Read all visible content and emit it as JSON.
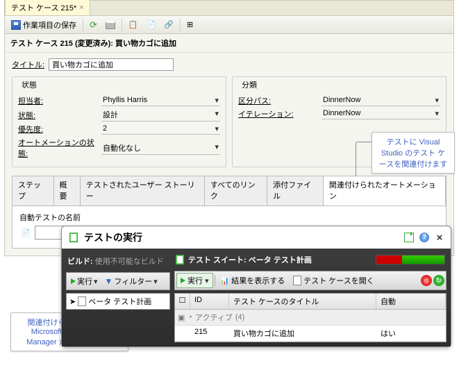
{
  "tab": {
    "title": "テスト ケース 215*"
  },
  "toolbar": {
    "save_label": "作業項目の保存"
  },
  "header": {
    "title": "テスト ケース 215 (変更済み): 買い物カゴに追加"
  },
  "title_field": {
    "label": "タイトル:",
    "value": "買い物カゴに追加"
  },
  "state": {
    "legend": "状態",
    "assigned_label": "担当者:",
    "assigned_value": "Phyllis Harris",
    "status_label": "状態:",
    "status_value": "設計",
    "priority_label": "優先度:",
    "priority_value": "2",
    "automation_label": "オートメーションの状態:",
    "automation_value": "自動化なし"
  },
  "classification": {
    "legend": "分類",
    "area_label": "区分パス:",
    "area_value": "DinnerNow",
    "iter_label": "イテレーション:",
    "iter_value": "DinnerNow"
  },
  "tabs": {
    "steps": "ステップ",
    "overview": "概要",
    "stories": "テストされたユーザー ストーリー",
    "links": "すべてのリンク",
    "attach": "添付ファイル",
    "automation": "関連付けられたオートメーション"
  },
  "auto_panel": {
    "name_label": "自動テストの名前",
    "value": "",
    "browse": "..."
  },
  "callout1": "テストに Visual Studio のテスト ケースを関連付けます",
  "callout2": "関連付けられたテストを Microsoft Test and Lab Manager から実行します",
  "runner": {
    "title": "テストの実行",
    "build_label": "ビルド:",
    "build_value": "使用不可能なビルド",
    "run_btn": "実行",
    "filter_btn": "フィルター",
    "plan_name": "ベータ テスト計画",
    "suite_label": "テスト スイート:",
    "suite_name": "ベータ テスト計画",
    "rt_run": "実行",
    "rt_results": "結果を表示する",
    "rt_open": "テスト ケースを開く",
    "col_id": "ID",
    "col_title": "テスト ケースのタイトル",
    "col_auto": "自動",
    "group_label": "アクティブ",
    "group_count": "(4)",
    "row": {
      "id": "215",
      "title": "買い物カゴに追加",
      "auto": "はい"
    }
  }
}
